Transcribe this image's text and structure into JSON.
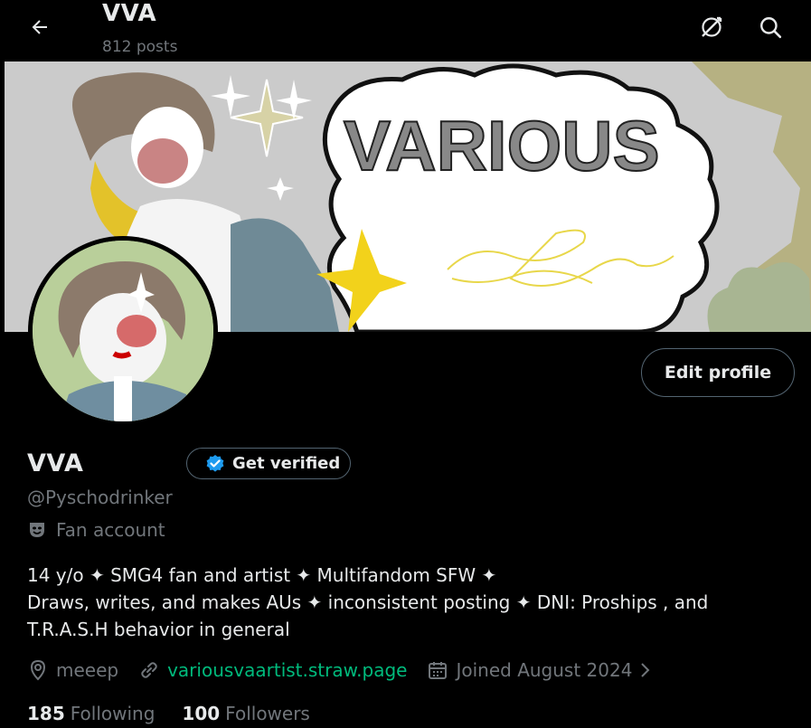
{
  "header": {
    "name": "VVA",
    "posts_count": "812 posts",
    "back_icon": "arrow-left-icon",
    "grok_icon": "grok-icon",
    "search_icon": "search-icon"
  },
  "banner": {
    "text": "VARIOUS"
  },
  "profile": {
    "display_name": "VVA",
    "get_verified_label": "Get verified",
    "handle": "@Pyschodrinker",
    "category": "Fan account",
    "edit_profile_label": "Edit profile",
    "bio_lines": [
      "14 y/o ✦ SMG4 fan and artist ✦ Multifandom SFW ✦",
      "Draws, writes, and makes AUs ✦ inconsistent posting ✦ DNI: Proships , and",
      "T.R.A.S.H behavior in general"
    ],
    "location": "meeep",
    "website": "variousvaartist.straw.page",
    "joined": "Joined August 2024",
    "following_count": "185",
    "following_label": "Following",
    "followers_count": "100",
    "followers_label": "Followers"
  },
  "colors": {
    "background": "#000000",
    "text_primary": "#e7e9ea",
    "text_secondary": "#71767b",
    "link": "#00ba7c",
    "verified_blue": "#1d9bf0",
    "border": "#536471"
  }
}
